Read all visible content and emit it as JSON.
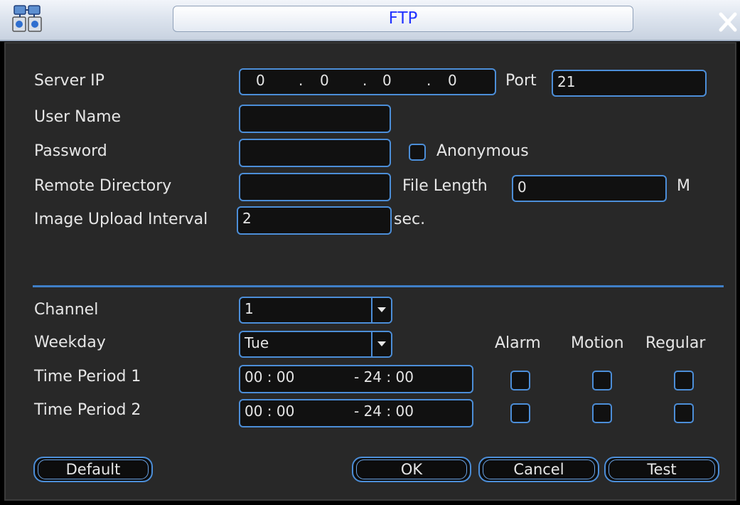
{
  "title": "FTP",
  "icons": {
    "app": "network-icon",
    "close": "close-icon"
  },
  "colors": {
    "accent": "#4c8ed8",
    "title_text": "#2233ff",
    "panel_bg": "#282828",
    "text": "#e6e6e6"
  },
  "labels": {
    "server_ip": "Server IP",
    "port": "Port",
    "user_name": "User Name",
    "password": "Password",
    "anonymous": "Anonymous",
    "remote_directory": "Remote Directory",
    "file_length": "File Length",
    "file_length_unit": "M",
    "image_upload_interval": "Image Upload Interval",
    "interval_unit": "sec.",
    "channel": "Channel",
    "weekday": "Weekday",
    "alarm": "Alarm",
    "motion": "Motion",
    "regular": "Regular",
    "time_period_1": "Time Period 1",
    "time_period_2": "Time Period 2"
  },
  "values": {
    "server_ip": [
      "0",
      "0",
      "0",
      "0"
    ],
    "ip_sep": ".",
    "port": "21",
    "user_name": "",
    "password": "",
    "remote_directory": "",
    "file_length": "0",
    "image_upload_interval": "2",
    "channel": "1",
    "weekday": "Tue",
    "time_period_1": {
      "start": "00 : 00",
      "end": "- 24 : 00"
    },
    "time_period_2": {
      "start": "00 : 00",
      "end": "- 24 : 00"
    },
    "anonymous_checked": false,
    "period1": {
      "alarm": false,
      "motion": false,
      "regular": false
    },
    "period2": {
      "alarm": false,
      "motion": false,
      "regular": false
    }
  },
  "buttons": {
    "default": "Default",
    "ok": "OK",
    "cancel": "Cancel",
    "test": "Test"
  }
}
